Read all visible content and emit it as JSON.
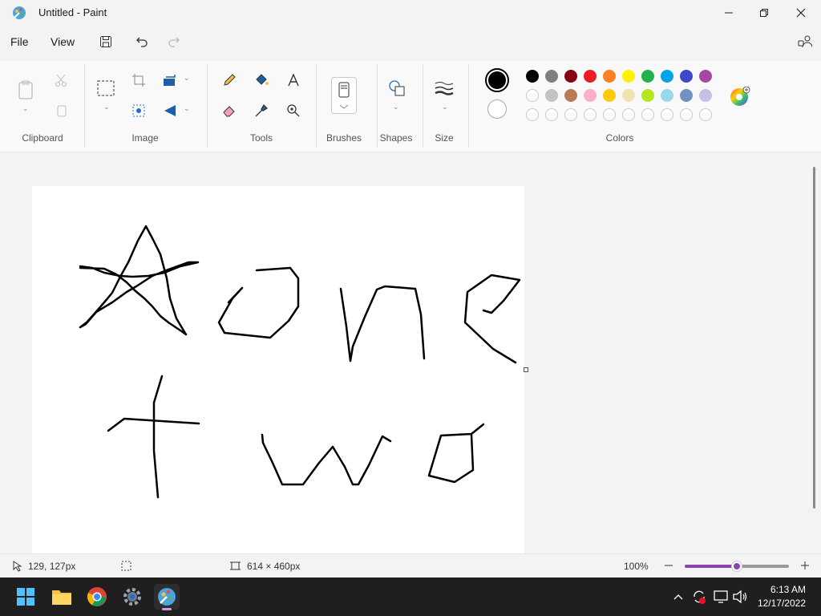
{
  "window": {
    "title": "Untitled - Paint"
  },
  "menu": {
    "file": "File",
    "view": "View"
  },
  "ribbon": {
    "groups": {
      "clipboard": "Clipboard",
      "image": "Image",
      "tools": "Tools",
      "brushes": "Brushes",
      "shapes": "Shapes",
      "size": "Size",
      "colors": "Colors"
    },
    "primary_color": "#000000",
    "secondary_color": "#ffffff",
    "palette_row1": [
      "#000000",
      "#7f7f7f",
      "#880015",
      "#ed1c24",
      "#ff7f27",
      "#fff200",
      "#22b14c",
      "#00a2e8",
      "#3f48cc",
      "#a349a4"
    ],
    "palette_row2": [
      "#ffffff",
      "#c3c3c3",
      "#b97a57",
      "#ffaec9",
      "#ffc90e",
      "#efe4b0",
      "#b5e61d",
      "#99d9ea",
      "#7092be",
      "#c8bfe7"
    ]
  },
  "status": {
    "cursor_pos": "129, 127px",
    "canvas_size": "614 × 460px",
    "zoom": "100%",
    "zoom_level": 0.5
  },
  "taskbar": {
    "time": "6:13 AM",
    "date": "12/17/2022"
  }
}
